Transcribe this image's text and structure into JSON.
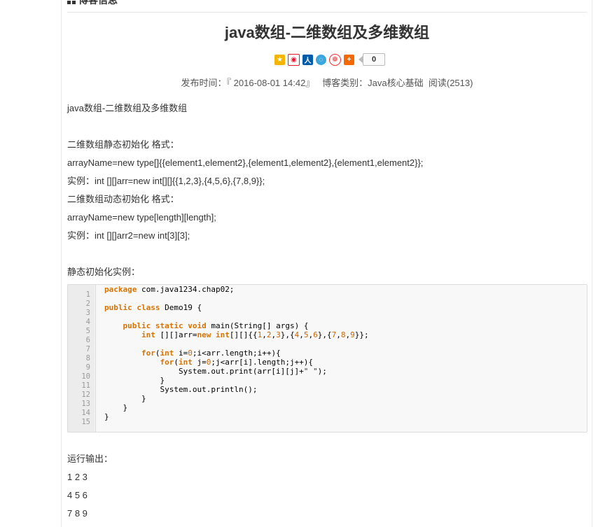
{
  "section": {
    "title": "博客信息"
  },
  "article": {
    "title": "java数组-二维数组及多维数组",
    "share": {
      "icons": [
        "qzone-icon",
        "weibo-icon",
        "renren-icon",
        "tqq-icon",
        "kaixin-icon",
        "more-icon"
      ],
      "count": "0"
    },
    "meta": {
      "published_label": "发布时间：",
      "published_value": "『 2016-08-01 14:42』",
      "category_label": "博客类别：",
      "category_value": "Java核心基础",
      "reads": "阅读(2513)"
    },
    "paragraphs": [
      "java数组-二维数组及多维数组",
      "二维数组静态初始化 格式：",
      "arrayName=new type[]{{element1,element2},{element1,element2},{element1,element2}};",
      "实例：int [][]arr=new int[][]{{1,2,3},{4,5,6},{7,8,9}};",
      "二维数组动态初始化 格式：",
      "arrayName=new type[length][length];",
      "实例：int [][]arr2=new int[3][3];",
      "静态初始化实例：",
      "运行输出：",
      "1 2 3",
      "4 5 6",
      "7 8 9"
    ],
    "code": {
      "line_numbers": [
        "1",
        "2",
        "3",
        "4",
        "5",
        "6",
        "7",
        "8",
        "9",
        "10",
        "11",
        "12",
        "13",
        "14",
        "15"
      ],
      "lines": [
        "package com.java1234.chap02;",
        "",
        "public class Demo19 {",
        "",
        "    public static void main(String[] args) {",
        "        int [][]arr=new int[][]{{1,2,3},{4,5,6},{7,8,9}};",
        "",
        "        for(int i=0;i<arr.length;i++){",
        "            for(int j=0;j<arr[i].length;j++){",
        "                System.out.print(arr[i][j]+\" \");",
        "            }",
        "            System.out.println();",
        "        }",
        "    }",
        "}"
      ]
    }
  },
  "colors": {
    "keyword": "#d97300",
    "text": "#333333",
    "gutter_bg": "#ececec",
    "code_bg": "#f8f8f8"
  }
}
